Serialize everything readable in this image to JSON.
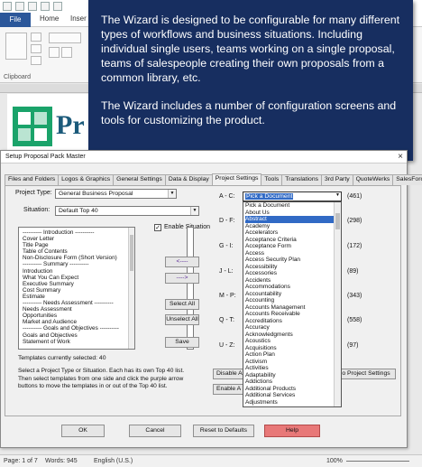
{
  "word": {
    "file_tab": "File",
    "home_tab": "Home",
    "insert_tab": "Inser",
    "clipboard_label": "Clipboard",
    "logo_letters": "Pr",
    "status": {
      "page": "Page: 1 of 7",
      "words": "Words: 945",
      "language": "English (U.S.)",
      "zoom": "100%"
    }
  },
  "callout": {
    "paragraph1": "The Wizard is designed to be configurable for many different types of workflows and business situations.  Including individual single users, teams working on a single proposal, teams of salespeople creating their own proposals from a common library, etc.",
    "paragraph2": "The Wizard includes a number of configuration screens and tools for customizing the product."
  },
  "dialog": {
    "title": "Setup Proposal Pack Master",
    "close_icon": "×",
    "tabs": [
      "Files and Folders",
      "Logos & Graphics",
      "General Settings",
      "Data & Display",
      "Project Settings",
      "Tools",
      "Translations",
      "3rd Party",
      "QuoteWerks",
      "SalesForce"
    ],
    "active_tab": "Project Settings",
    "project_type_label": "Project Type:",
    "project_type_value": "General Business Proposal",
    "situation_label": "Situation:",
    "situation_value": "Default Top 40",
    "enable_situation_label": "Enable Situation",
    "enable_situation_checked": true,
    "template_list": [
      "---------- Introduction ----------",
      "Cover Letter",
      "Title Page",
      "Table of Contents",
      "Non-Disclosure Form (Short Version)",
      "---------- Summary ----------",
      "Introduction",
      "What You Can Expect",
      "Executive Summary",
      "Cost Summary",
      "Estimate",
      "---------- Needs Assessment ----------",
      "Needs Assessment",
      "Opportunities",
      "Market and Audience",
      "---------- Goals and Objectives ----------",
      "Goals and Objectives",
      "Statement of Work"
    ],
    "move_left_label": "<----",
    "move_right_label": "---->",
    "select_all_label": "Select All",
    "unselect_all_label": "Unselect All",
    "save_label": "Save",
    "templates_selected": "Templates currently selected: 40",
    "help_text": "Select a Project Type or Situation. Each has its own Top 40 list. Then select templates from one side and click the purple arrow buttons to move the templates in or out of the Top 40 list.",
    "range_rows": [
      {
        "label": "A - C:",
        "count": "(461)"
      },
      {
        "label": "D - F:",
        "count": "(298)"
      },
      {
        "label": "G - I:",
        "count": "(172)"
      },
      {
        "label": "J - L:",
        "count": "(89)"
      },
      {
        "label": "M - P:",
        "count": "(343)"
      },
      {
        "label": "Q - T:",
        "count": "(558)"
      },
      {
        "label": "U - Z:",
        "count": "(97)"
      }
    ],
    "pick_document": "Pick a Document",
    "disable_partial": "Disable A",
    "enable_partial": "Enable A",
    "project_settings_partial": "o Project Settings",
    "ok_label": "OK",
    "cancel_label": "Cancel",
    "reset_label": "Reset to Defaults",
    "help_label": "Help"
  },
  "document_dropdown": [
    "Pick a Document",
    "About Us",
    "Abstract",
    "Academy",
    "Accelerators",
    "Acceptance Criteria",
    "Acceptance Form",
    "Access",
    "Access Security Plan",
    "Accessibility",
    "Accessories",
    "Accidents",
    "Accommodations",
    "Accountability",
    "Accounting",
    "Accounts Management",
    "Accounts Receivable",
    "Accreditations",
    "Accuracy",
    "Acknowledgments",
    "Acoustics",
    "Acquisitions",
    "Action Plan",
    "Activism",
    "Activities",
    "Adaptability",
    "Addictions",
    "Additional Products",
    "Additional Services",
    "Adjustments"
  ],
  "highlighted_item": "Abstract",
  "colors": {
    "callout_bg": "#172e60",
    "word_blue": "#2b579a",
    "highlight": "#316ac5",
    "help_button": "#e87878",
    "logo_green": "#1aa36a"
  }
}
